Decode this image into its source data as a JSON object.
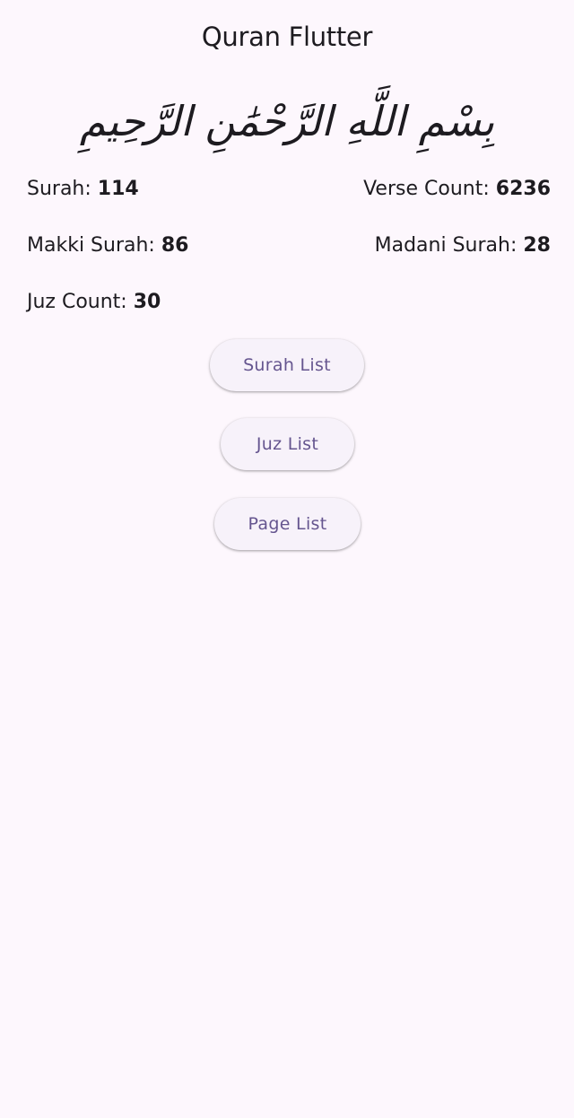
{
  "app_bar": {
    "title": "Quran Flutter"
  },
  "bismillah": "بِسْمِ اللَّهِ الرَّحْمَٰنِ الرَّحِيمِ",
  "stats": {
    "surah": {
      "label": "Surah:",
      "value": "114"
    },
    "verse_count": {
      "label": "Verse Count:",
      "value": "6236"
    },
    "makki_surah": {
      "label": "Makki Surah:",
      "value": "86"
    },
    "madani_surah": {
      "label": "Madani Surah:",
      "value": "28"
    },
    "juz_count": {
      "label": "Juz Count:",
      "value": "30"
    }
  },
  "buttons": {
    "surah_list": "Surah List",
    "juz_list": "Juz List",
    "page_list": "Page List"
  },
  "colors": {
    "background": "#fdf7fd",
    "button_background": "#f7f2fa",
    "button_text": "#65558f",
    "text": "#1d1b20"
  }
}
